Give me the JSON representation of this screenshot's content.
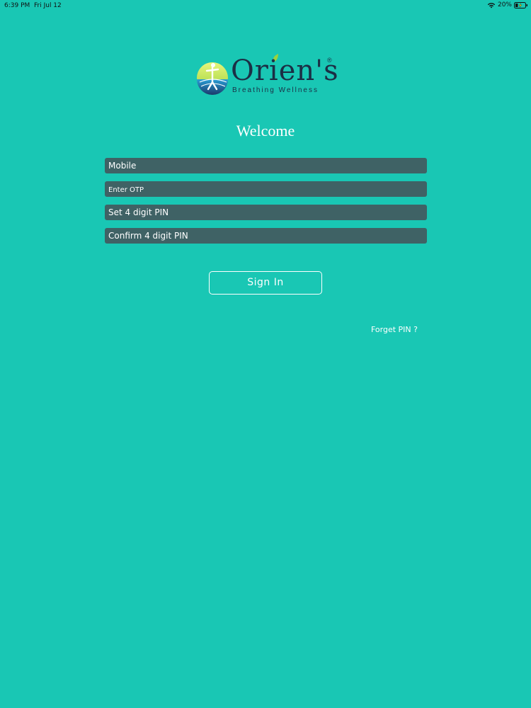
{
  "status_bar": {
    "time": "6:39 PM",
    "date": "Fri Jul 12",
    "battery": "20%",
    "wifi_icon": "wifi-icon",
    "battery_icon": "battery-charging-icon"
  },
  "logo": {
    "word": "Orien's",
    "registered": "®",
    "tagline": "Breathing Wellness"
  },
  "welcome": "Welcome",
  "form": {
    "mobile_placeholder": "Mobile",
    "otp_placeholder": "Enter OTP",
    "pin_placeholder": "Set 4 digit PIN",
    "confirm_pin_placeholder": "Confirm 4 digit PIN",
    "signin_label": "Sign In",
    "forget_pin_label": "Forget PIN ?"
  },
  "colors": {
    "background": "#19c7b4",
    "field_bg": "#3f6265",
    "logo_text": "#1b2f45"
  }
}
